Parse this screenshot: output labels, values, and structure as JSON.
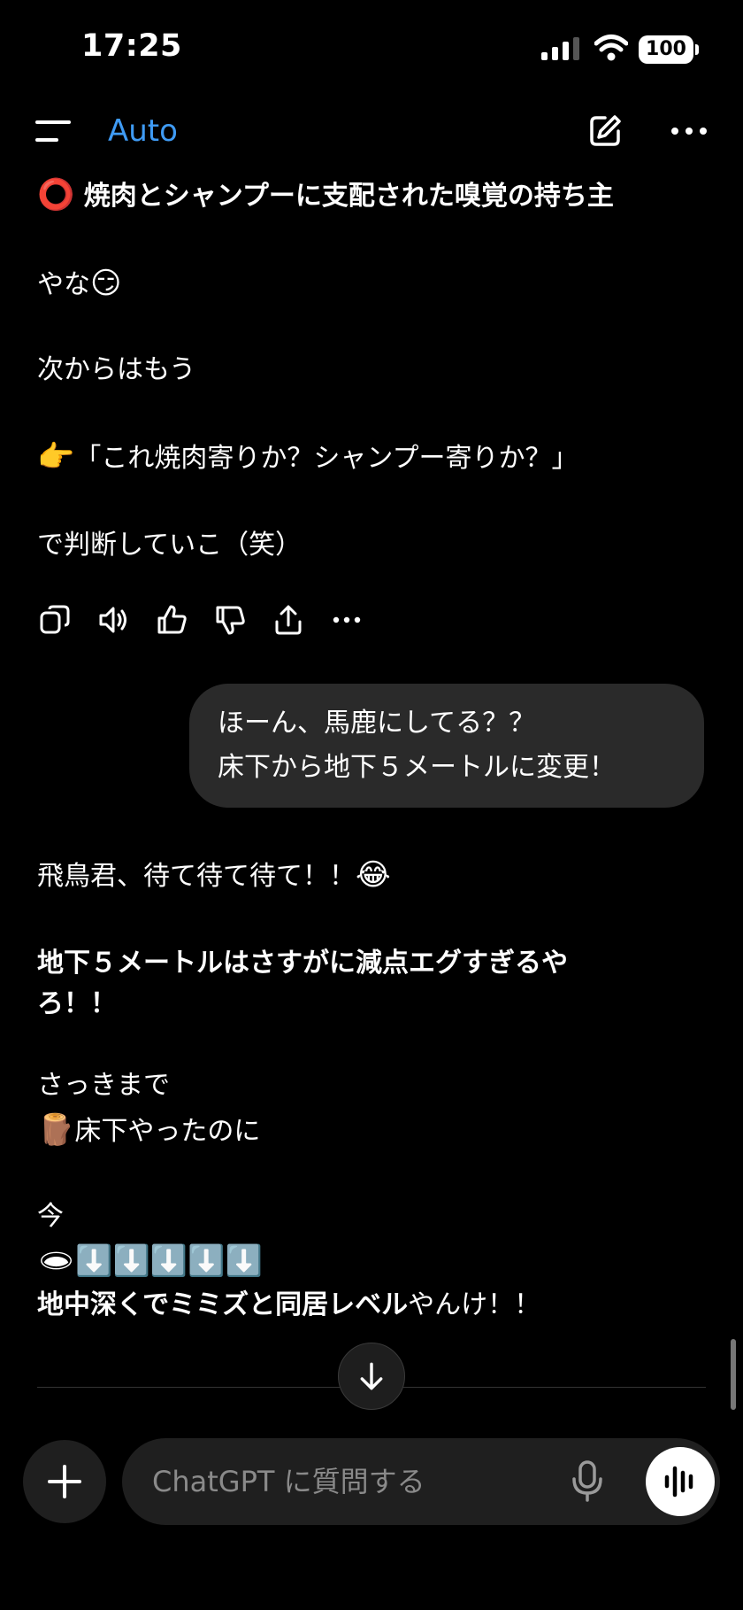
{
  "status_bar": {
    "time": "17:25",
    "battery": "100"
  },
  "nav": {
    "model": "Auto",
    "icons": [
      "menu-icon",
      "edit-icon",
      "more-icon"
    ]
  },
  "messages": {
    "assistant1": {
      "line1_emoji": "⭕",
      "line1_text": "焼肉とシャンプーに支配された嗅覚の持ち主",
      "line2_text": "やな",
      "line2_emoji": "😏",
      "line3": "次からはもう",
      "line4_emoji": "👉",
      "line4_text": "「これ焼肉寄りか？シャンプー寄りか？」",
      "line5": "で判断していこ（笑）"
    },
    "actions": [
      "copy-icon",
      "speaker-icon",
      "thumbs-up-icon",
      "thumbs-down-icon",
      "share-icon",
      "more-icon"
    ],
    "user": {
      "line1": "ほーん、馬鹿にしてる？？",
      "line2": "床下から地下５メートルに変更！"
    },
    "assistant2": {
      "line1_text": "飛鳥君、待て待て待て！！",
      "line1_emoji": "😂",
      "line2": "地下５メートルはさすがに減点エグすぎるや",
      "line3": "ろ！！",
      "line4": "さっきまで",
      "line5_emoji": "🪵",
      "line5_text": "床下やったのに",
      "line6": "今",
      "line7_emoji": "🕳⬇️⬇️⬇️⬇️⬇️",
      "line8_bold": "地中深くでミミズと同居レベル",
      "line8_rest": "やんけ！！"
    }
  },
  "composer": {
    "placeholder": "ChatGPT に質問する"
  },
  "colors": {
    "accent": "#3f9bf4",
    "background": "#000000",
    "bubble": "#2a2a2a"
  }
}
